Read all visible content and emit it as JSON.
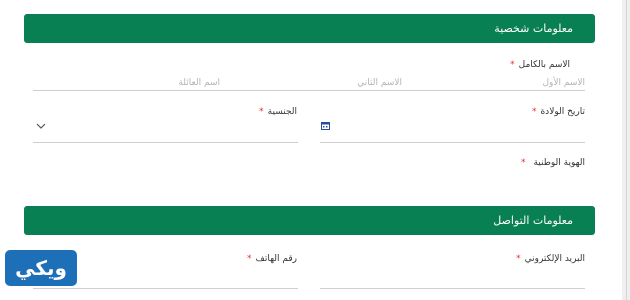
{
  "personal_section": {
    "title": "معلومات شخصية"
  },
  "full_name": {
    "label": "الاسم بالكامل",
    "required_mark": "*",
    "first_placeholder": "الاسم الأول",
    "second_placeholder": "الاسم الثاني",
    "family_placeholder": "اسم العائلة"
  },
  "birth_date": {
    "label": "تاريخ الولادة",
    "required_mark": "*",
    "icon": "calendar-icon"
  },
  "nationality": {
    "label": "الجنسية",
    "required_mark": "*",
    "icon": "chevron-down-icon"
  },
  "national_id": {
    "label": "الهوية الوطنية",
    "required_mark": "*"
  },
  "contact_section": {
    "title": "معلومات التواصل"
  },
  "email": {
    "label": "البريد الإلكتروني",
    "required_mark": "*"
  },
  "phone": {
    "label": "رقم الهاتف",
    "required_mark": "*"
  },
  "watermark": {
    "text": "ويكي"
  },
  "colors": {
    "section_bar": "#097f54",
    "required": "#e03030",
    "logo": "#1d6fb8"
  }
}
